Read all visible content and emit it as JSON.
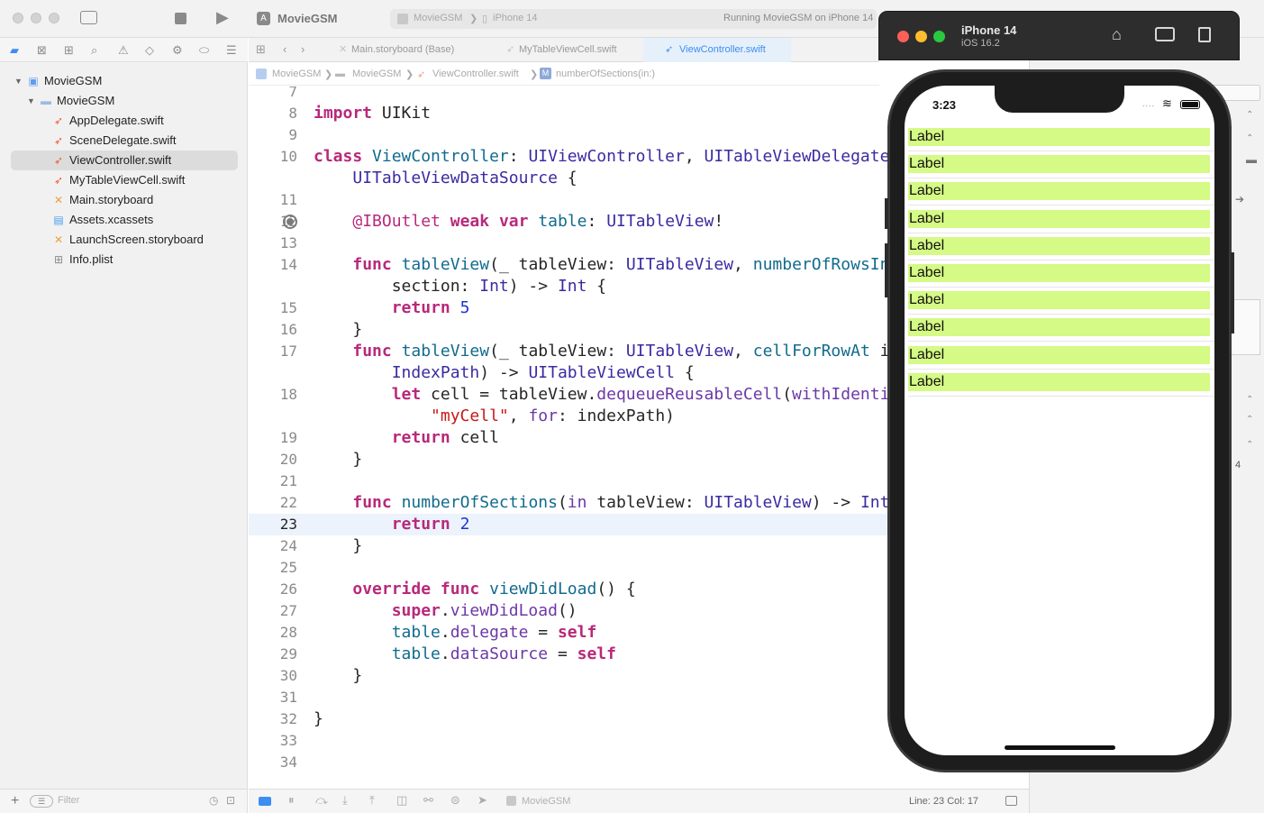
{
  "toolbar": {
    "project_name": "MovieGSM",
    "scheme": "MovieGSM",
    "device": "iPhone 14",
    "status": "Running MovieGSM on iPhone 14"
  },
  "navigator": {
    "filter_placeholder": "Filter",
    "items": [
      {
        "label": "MovieGSM",
        "type": "project"
      },
      {
        "label": "MovieGSM",
        "type": "folder"
      },
      {
        "label": "AppDelegate.swift",
        "type": "swift"
      },
      {
        "label": "SceneDelegate.swift",
        "type": "swift"
      },
      {
        "label": "ViewController.swift",
        "type": "swift",
        "selected": true
      },
      {
        "label": "MyTableViewCell.swift",
        "type": "swift"
      },
      {
        "label": "Main.storyboard",
        "type": "storyboard"
      },
      {
        "label": "Assets.xcassets",
        "type": "assets"
      },
      {
        "label": "LaunchScreen.storyboard",
        "type": "storyboard"
      },
      {
        "label": "Info.plist",
        "type": "plist"
      }
    ]
  },
  "tabs": [
    {
      "label": "Main.storyboard (Base)"
    },
    {
      "label": "MyTableViewCell.swift"
    },
    {
      "label": "ViewController.swift",
      "active": true
    }
  ],
  "breadcrumb": [
    "MovieGSM",
    "MovieGSM",
    "ViewController.swift",
    "numberOfSections(in:)"
  ],
  "breadcrumb_symbol": "M",
  "editor": {
    "line_numbers": [
      "7",
      "8",
      "9",
      "10",
      "",
      "11",
      "12",
      "13",
      "14",
      "",
      "15",
      "16",
      "17",
      "",
      "18",
      "",
      "19",
      "20",
      "21",
      "22",
      "23",
      "24",
      "25",
      "26",
      "27",
      "28",
      "29",
      "30",
      "31",
      "32",
      "33",
      "34"
    ],
    "current_line": "23"
  },
  "status_bar": {
    "scheme": "MovieGSM",
    "cursor": "Line: 23  Col: 17",
    "inspector_value": "4"
  },
  "simulator": {
    "device_name": "iPhone 14",
    "os": "iOS 16.2",
    "time": "3:23",
    "cells": [
      "Label",
      "Label",
      "Label",
      "Label",
      "Label",
      "Label",
      "Label",
      "Label",
      "Label",
      "Label"
    ]
  },
  "colors": {
    "cell_background": "#d5fa85",
    "active_tab": "#3c8ef0",
    "keyword": "#b8297b"
  }
}
